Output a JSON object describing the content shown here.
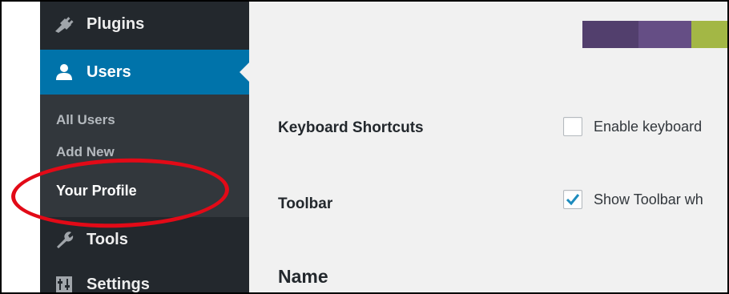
{
  "sidebar": {
    "items": {
      "plugins": {
        "label": "Plugins",
        "icon": "plugins-icon"
      },
      "users": {
        "label": "Users",
        "icon": "users-icon",
        "active": true
      },
      "tools": {
        "label": "Tools",
        "icon": "tools-icon"
      },
      "settings": {
        "label": "Settings",
        "icon": "settings-icon"
      }
    },
    "users_submenu": [
      {
        "label": "All Users"
      },
      {
        "label": "Add New"
      },
      {
        "label": "Your Profile",
        "current": true
      }
    ]
  },
  "main": {
    "admin_color_scheme_swatches": [
      "#523f6d",
      "#654e85",
      "#a3b745"
    ],
    "keyboard_shortcuts": {
      "label": "Keyboard Shortcuts",
      "option_text": "Enable keyboard",
      "checked": false
    },
    "toolbar": {
      "label": "Toolbar",
      "option_text": "Show Toolbar wh",
      "checked": true
    },
    "name_heading": "Name"
  },
  "colors": {
    "sidebar_bg": "#23282d",
    "submenu_bg": "#32373c",
    "accent_blue": "#0073aa",
    "highlight_ring": "#e20a17",
    "content_bg": "#f1f1f1"
  }
}
